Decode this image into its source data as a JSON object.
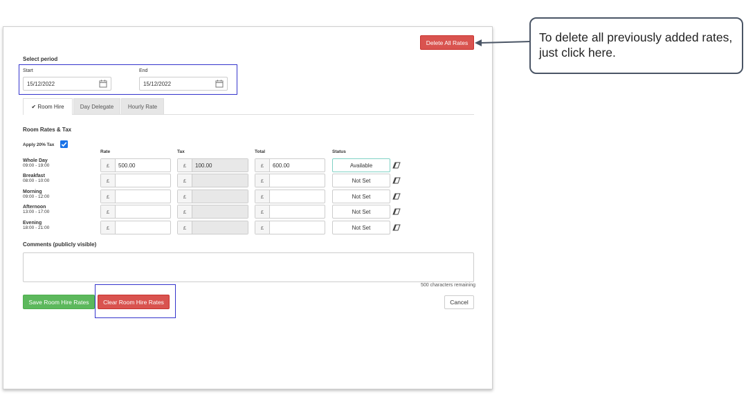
{
  "header": {
    "delete_all_label": "Delete All Rates"
  },
  "period": {
    "heading": "Select period",
    "start_label": "Start",
    "start_value": "15/12/2022",
    "end_label": "End",
    "end_value": "15/12/2022"
  },
  "tabs": [
    {
      "label": "Room Hire",
      "active": true
    },
    {
      "label": "Day Delegate",
      "active": false
    },
    {
      "label": "Hourly Rate",
      "active": false
    }
  ],
  "rates": {
    "heading": "Room Rates & Tax",
    "apply_tax_label": "Apply 20% Tax",
    "apply_tax_checked": true,
    "col_rate": "Rate",
    "col_tax": "Tax",
    "col_total": "Total",
    "col_status": "Status",
    "currency": "£",
    "rows": [
      {
        "name": "Whole Day",
        "time": "09:00 - 19:00",
        "rate": "500.00",
        "tax": "100.00",
        "total": "600.00",
        "status": "Available"
      },
      {
        "name": "Breakfast",
        "time": "08:00 - 10:00",
        "rate": "",
        "tax": "",
        "total": "",
        "status": "Not Set"
      },
      {
        "name": "Morning",
        "time": "09:00 - 12:00",
        "rate": "",
        "tax": "",
        "total": "",
        "status": "Not Set"
      },
      {
        "name": "Afternoon",
        "time": "13:00 - 17:00",
        "rate": "",
        "tax": "",
        "total": "",
        "status": "Not Set"
      },
      {
        "name": "Evening",
        "time": "18:00 - 21:00",
        "rate": "",
        "tax": "",
        "total": "",
        "status": "Not Set"
      }
    ]
  },
  "comments": {
    "label": "Comments (publicly visible)",
    "value": "",
    "remaining": "500 characters remaining"
  },
  "actions": {
    "save_label": "Save Room Hire Rates",
    "clear_label": "Clear Room Hire Rates",
    "cancel_label": "Cancel"
  },
  "callout": {
    "text": "To delete all previously added rates, just click here."
  },
  "colors": {
    "danger": "#d9534f",
    "success": "#5cb85c",
    "highlight": "#3333cc",
    "check": "#1a73e8"
  }
}
